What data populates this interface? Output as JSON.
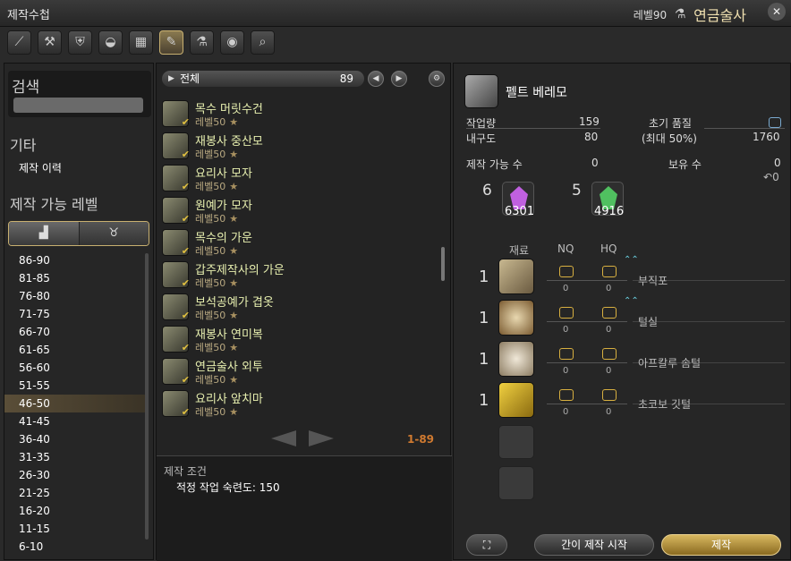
{
  "window": {
    "title": "제작수첩",
    "level_label": "레벨90",
    "job_name": "연금술사"
  },
  "toolbar": {
    "icons": [
      "carpenter-icon",
      "blacksmith-icon",
      "armorer-icon",
      "goldsmith-icon",
      "leatherworker-icon",
      "weaver-icon",
      "alchemist-icon",
      "culinarian-icon",
      "search-icon"
    ]
  },
  "left": {
    "search_label": "검색",
    "other_label": "기타",
    "history_label": "제작 이력",
    "craft_level_label": "제작 가능 레벨",
    "levels": [
      "86-90",
      "81-85",
      "76-80",
      "71-75",
      "66-70",
      "61-65",
      "56-60",
      "51-55",
      "46-50",
      "41-45",
      "36-40",
      "31-35",
      "26-30",
      "21-25",
      "16-20",
      "11-15",
      "6-10"
    ],
    "selected_level": "46-50"
  },
  "middle": {
    "category": "전체",
    "count": "89",
    "items": [
      {
        "name": "목수 머릿수건",
        "level": "레벨50"
      },
      {
        "name": "재봉사 중산모",
        "level": "레벨50"
      },
      {
        "name": "요리사 모자",
        "level": "레벨50"
      },
      {
        "name": "원예가 모자",
        "level": "레벨50"
      },
      {
        "name": "목수의 가운",
        "level": "레벨50"
      },
      {
        "name": "갑주제작사의 가운",
        "level": "레벨50"
      },
      {
        "name": "보석공예가 겹옷",
        "level": "레벨50"
      },
      {
        "name": "재봉사 연미복",
        "level": "레벨50"
      },
      {
        "name": "연금술사 외투",
        "level": "레벨50"
      },
      {
        "name": "요리사 앞치마",
        "level": "레벨50"
      }
    ],
    "star": "★",
    "range": "1-89",
    "condition_title": "제작 조건",
    "condition_value": "적정 작업 숙련도: 150"
  },
  "right": {
    "item_name": "펠트 베레모",
    "progress_label": "작업량",
    "progress_value": "159",
    "durability_label": "내구도",
    "durability_value": "80",
    "quality_label": "초기 품질",
    "max_quality_label": "(최대 50%)",
    "max_quality_value": "1760",
    "craftable_label": "제작 가능 수",
    "craftable_value": "0",
    "owned_label": "보유 수",
    "owned_value": "0",
    "owned_sub": "0",
    "crystals": [
      {
        "qty": "6",
        "have": "6301",
        "color": "#c060e0"
      },
      {
        "qty": "5",
        "have": "4916",
        "color": "#50c060"
      }
    ],
    "mat_header": "재료",
    "nq_header": "NQ",
    "hq_header": "HQ",
    "materials": [
      {
        "qty": "1",
        "name": "부직포",
        "nq": "0",
        "hq": "0",
        "hq_up": true
      },
      {
        "qty": "1",
        "name": "털실",
        "nq": "0",
        "hq": "0",
        "hq_up": true
      },
      {
        "qty": "1",
        "name": "아프칼루 솜털",
        "nq": "0",
        "hq": "0",
        "hq_up": false
      },
      {
        "qty": "1",
        "name": "초코보 깃털",
        "nq": "0",
        "hq": "0",
        "hq_up": false
      }
    ],
    "quick_synth_label": "간이 제작 시작",
    "synth_label": "제작"
  }
}
